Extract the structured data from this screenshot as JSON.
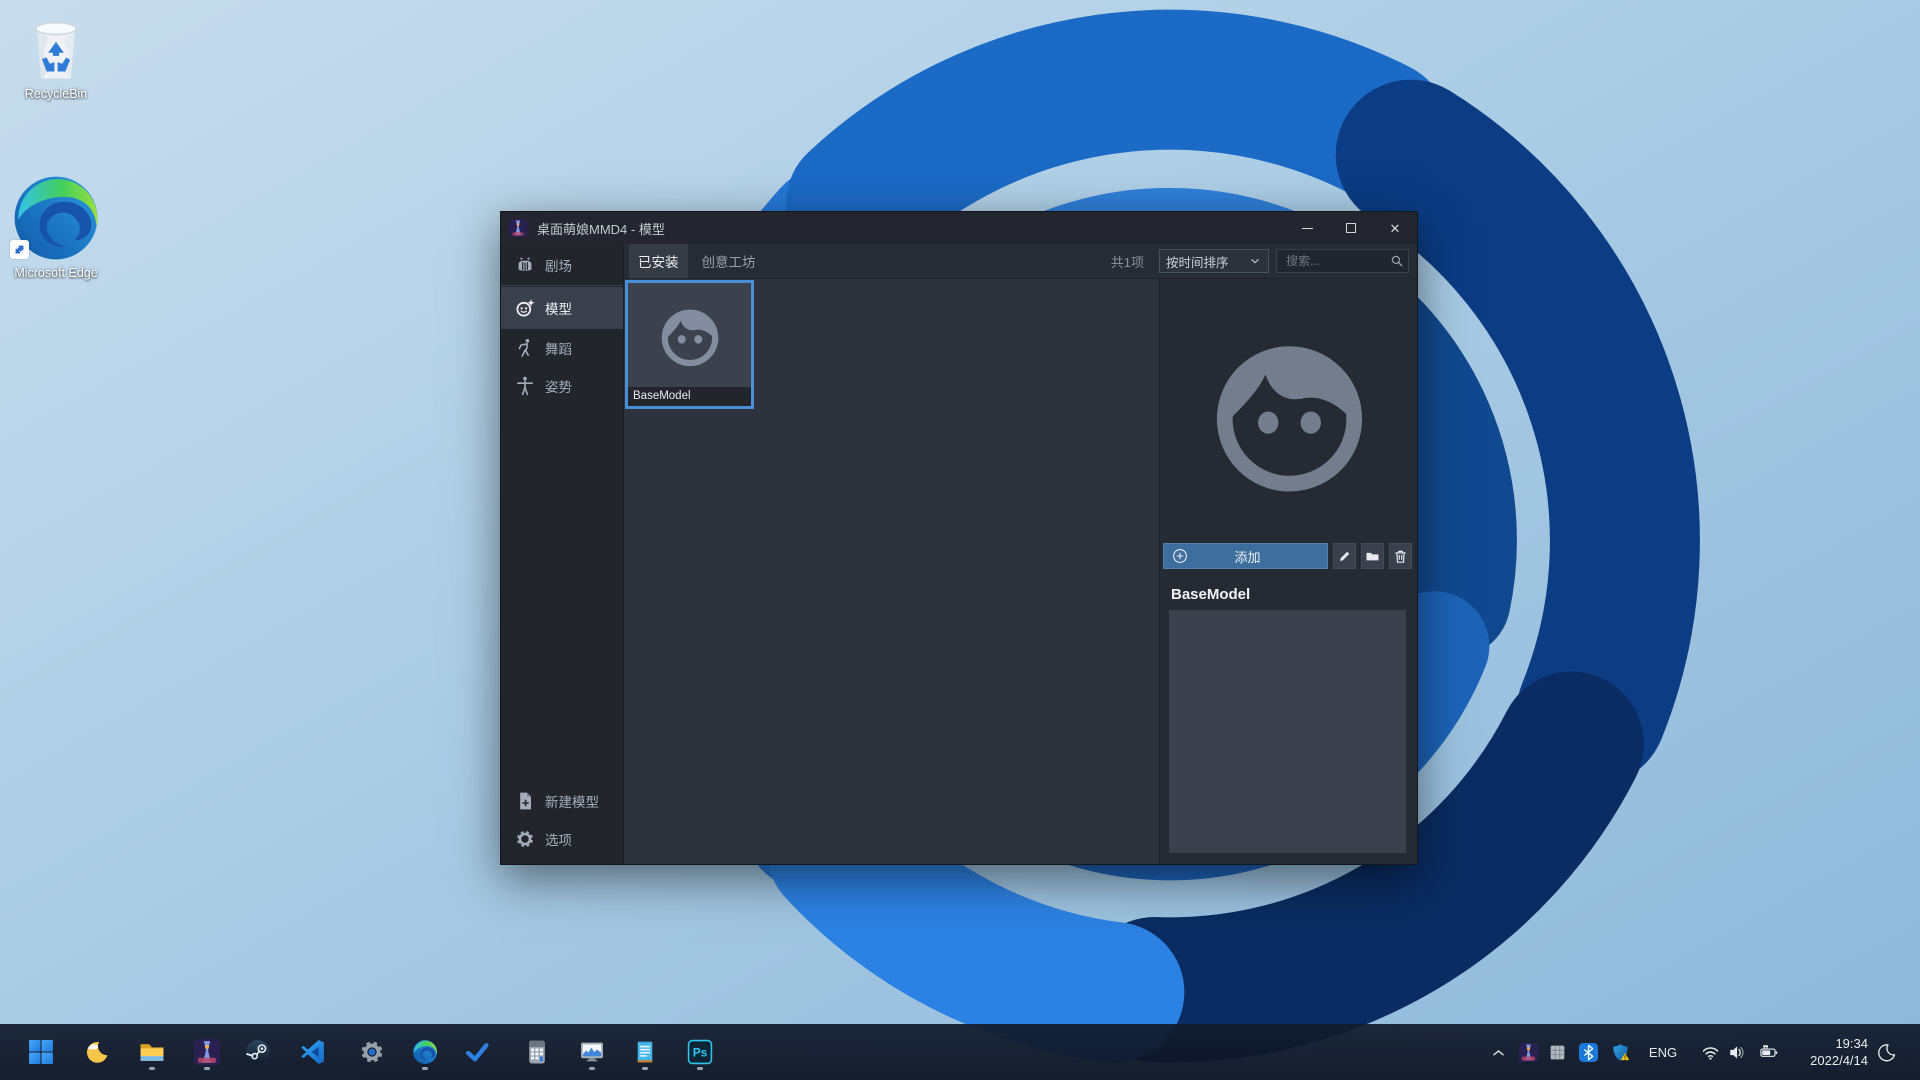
{
  "colors": {
    "selection_accent": "#4a8ed8",
    "add_button_blue": "#3e6e9e",
    "window_dark": "#23262e",
    "sidebar_dark": "#22252c",
    "content_dark": "#2d323c",
    "taskbar_bg": "#121b2c",
    "wallpaper_blues": [
      "#2c82e2",
      "#1b6ac6",
      "#0b3c84",
      "#0a2c62"
    ]
  },
  "desktop": {
    "icons": [
      {
        "label": "RecycleBin"
      },
      {
        "label": "Microsoft Edge"
      }
    ]
  },
  "window": {
    "title": "桌面萌娘MMD4 - 模型",
    "controls": {
      "minimize": "minimize",
      "maximize": "maximize",
      "close": "close"
    },
    "sidebar": {
      "items": [
        {
          "label": "剧场",
          "icon": "theater-icon",
          "selected": false
        },
        {
          "label": "模型",
          "icon": "model-face-icon",
          "selected": true
        },
        {
          "label": "舞蹈",
          "icon": "dance-icon",
          "selected": false
        },
        {
          "label": "姿势",
          "icon": "pose-icon",
          "selected": false
        }
      ],
      "bottom_items": [
        {
          "label": "新建模型",
          "icon": "file-plus-icon"
        },
        {
          "label": "选项",
          "icon": "gear-icon"
        }
      ]
    },
    "toolbar": {
      "tabs": [
        {
          "label": "已安装",
          "active": true
        },
        {
          "label": "创意工坊",
          "active": false
        }
      ],
      "count": "共1项",
      "sort_value": "按时间排序",
      "search_placeholder": "搜索..."
    },
    "content": {
      "cards": [
        {
          "label": "BaseModel",
          "selected": true
        }
      ]
    },
    "detail": {
      "add_label": "添加",
      "action_icons": [
        "pencil-icon",
        "folder-icon",
        "trash-icon"
      ],
      "model_name": "BaseModel"
    }
  },
  "taskbar": {
    "items": [
      {
        "name": "start",
        "running": false
      },
      {
        "name": "weather-moon",
        "running": false
      },
      {
        "name": "file-explorer",
        "running": true
      },
      {
        "name": "mmd-app",
        "running": true
      },
      {
        "name": "steam",
        "running": false
      },
      {
        "name": "vscode",
        "running": false
      },
      {
        "name": "settings",
        "running": false
      },
      {
        "name": "edge",
        "running": true
      },
      {
        "name": "todo-check",
        "running": false
      },
      {
        "name": "calculator",
        "running": false
      },
      {
        "name": "task-manager",
        "running": true
      },
      {
        "name": "notepad",
        "running": true
      },
      {
        "name": "photoshop",
        "running": true
      }
    ],
    "tray": {
      "icons": [
        "chevron-up",
        "mmd-tray",
        "grid-app",
        "bluetooth",
        "security-shield-warning",
        "wifi",
        "speaker",
        "battery-charging",
        "focus-moon"
      ],
      "language": "ENG",
      "time": "19:34",
      "date": "2022/4/14"
    }
  }
}
